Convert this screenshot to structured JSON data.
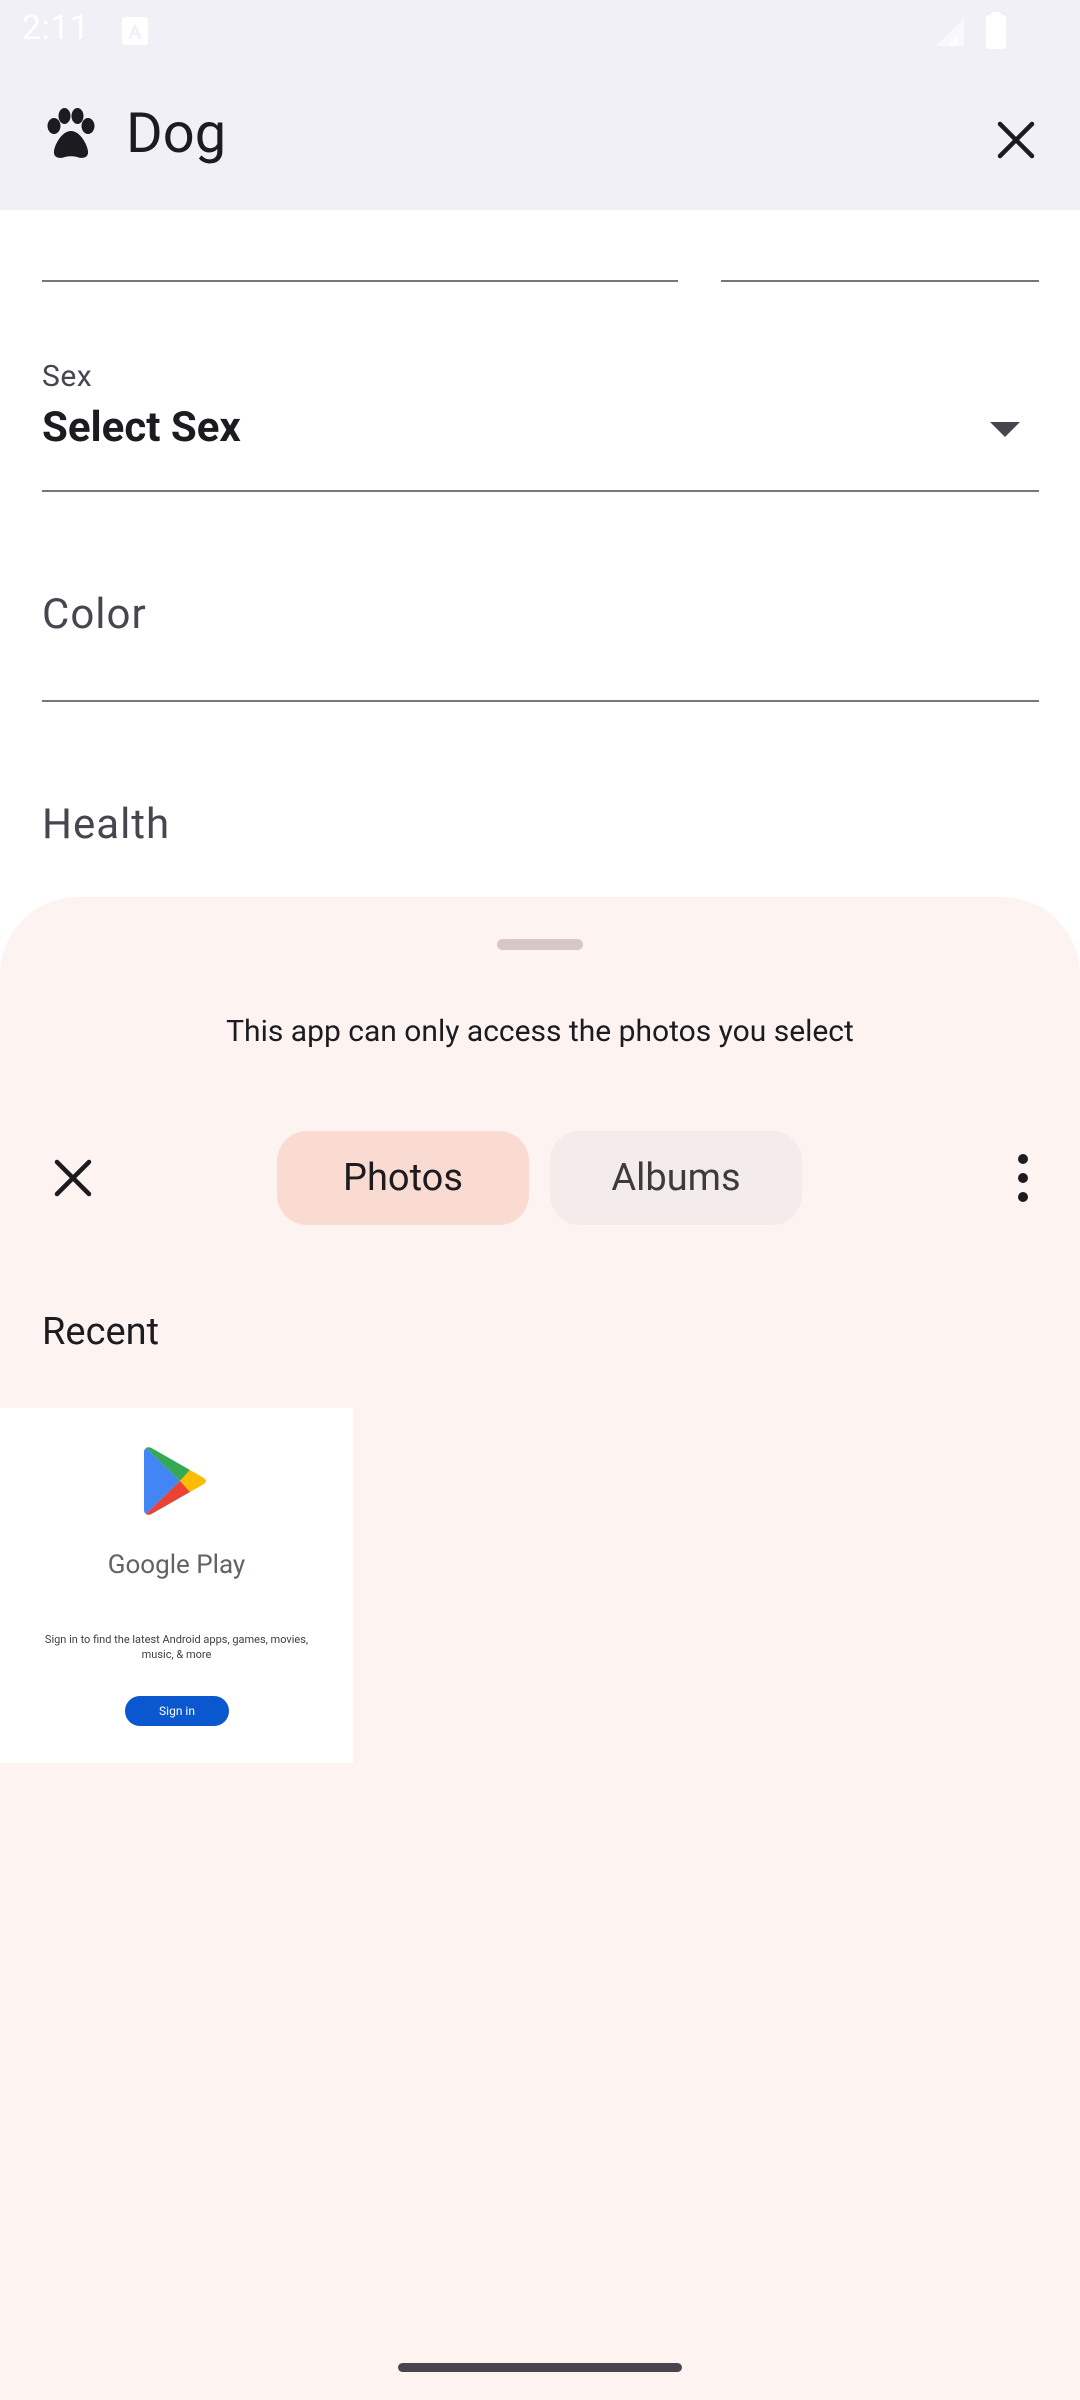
{
  "status_bar": {
    "time": "2:11",
    "icons": [
      "a-notification-icon",
      "signal-icon",
      "battery-icon"
    ]
  },
  "app_bar": {
    "title": "Dog",
    "leading_icon": "paw-icon",
    "close_icon": "close-icon"
  },
  "form": {
    "sex": {
      "label": "Sex",
      "value": "Select Sex"
    },
    "color": {
      "placeholder": "Color"
    },
    "health": {
      "placeholder": "Health"
    }
  },
  "photo_picker": {
    "message": "This app can only access the photos you select",
    "tabs": [
      {
        "label": "Photos",
        "selected": true
      },
      {
        "label": "Albums",
        "selected": false
      }
    ],
    "section_title": "Recent",
    "thumbnail": {
      "brand": "Google Play",
      "description": "Sign in to find the latest Android apps, games, movies, music, & more",
      "button": "Sign in"
    }
  },
  "colors": {
    "app_bar_bg": "#f1f0f6",
    "sheet_bg": "#fdf4f2",
    "tab_selected_bg": "#f9dbd2",
    "tab_unselected_bg": "#f3ecea",
    "signin_button": "#0b57d0"
  }
}
